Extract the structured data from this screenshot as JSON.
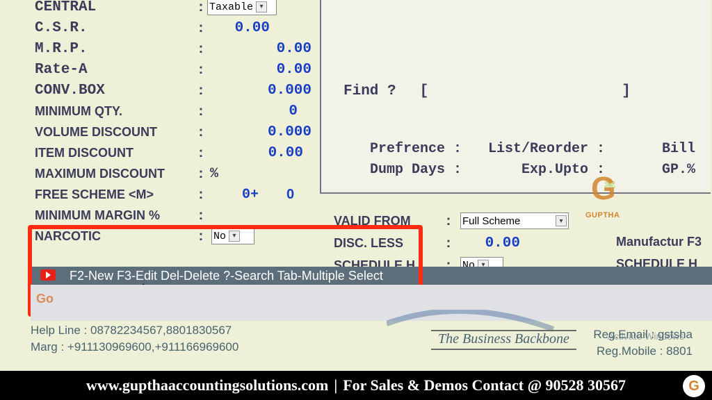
{
  "form": {
    "central_label": "CENTRAL",
    "central_select": "Taxable",
    "csr_label": "C.S.R.",
    "csr_value": "0.00",
    "mrp_label": "M.R.P.",
    "mrp_value": "0.00",
    "ratea_label": "Rate-A",
    "ratea_value": "0.00",
    "convbox_label": "CONV.BOX",
    "convbox_value": "0.000",
    "minqty_label": "MINIMUM QTY.",
    "minqty_value": "0",
    "voldisc_label": "VOLUME DISCOUNT",
    "voldisc_value": "0.000",
    "itemdisc_label": "ITEM DISCOUNT",
    "itemdisc_value": "0.00",
    "maxdisc_label": "MAXIMUM DISCOUNT",
    "maxdisc_pct": "%",
    "free_label": "FREE SCHEME <M>",
    "free_value": "0+",
    "free_right": "0",
    "minmargin_label": "MINIMUM MARGIN %",
    "narcotic_label": "NARCOTIC",
    "narcotic_select": "No"
  },
  "right": {
    "find_label": "Find ?",
    "find_lb": "[",
    "find_rb": "]",
    "pref_label": "Prefrence :",
    "reorder_label": "List/Reorder :",
    "bill_label": "Bill",
    "dump_label": "Dump Days :",
    "exp_label": "Exp.Upto :",
    "gp_label": "GP.%",
    "validfrom_label": "VALID FROM",
    "validfrom_select": "Full Scheme",
    "discless_label": "DISC. LESS",
    "discless_value": "0.00",
    "schedh_label": "SCHEDULE H",
    "schedh_select": "No",
    "manuf_label": "Manufactur F3",
    "schedh_l_label": "SCHEDULE H"
  },
  "logo": {
    "letter": "G",
    "caption": "GUPTHA"
  },
  "statusbar": "F2-New F3-Edit Del-Delete ?-Search Tab-Multiple Select",
  "help": {
    "line1": "Help Line : 08782234567,8801830567",
    "line2": "Marg : +911130969600,+911166969600"
  },
  "reg": {
    "email": "Reg.Email : gstsha",
    "mobile": "Reg.Mobile : 8801"
  },
  "activate": "Activate Windows",
  "backbone": "The Business Backbone",
  "blur_go": "Go",
  "footer": {
    "site": "www.gupthaaccountingsolutions.com",
    "tag": "For Sales & Demos Contact @ 90528 30567"
  }
}
